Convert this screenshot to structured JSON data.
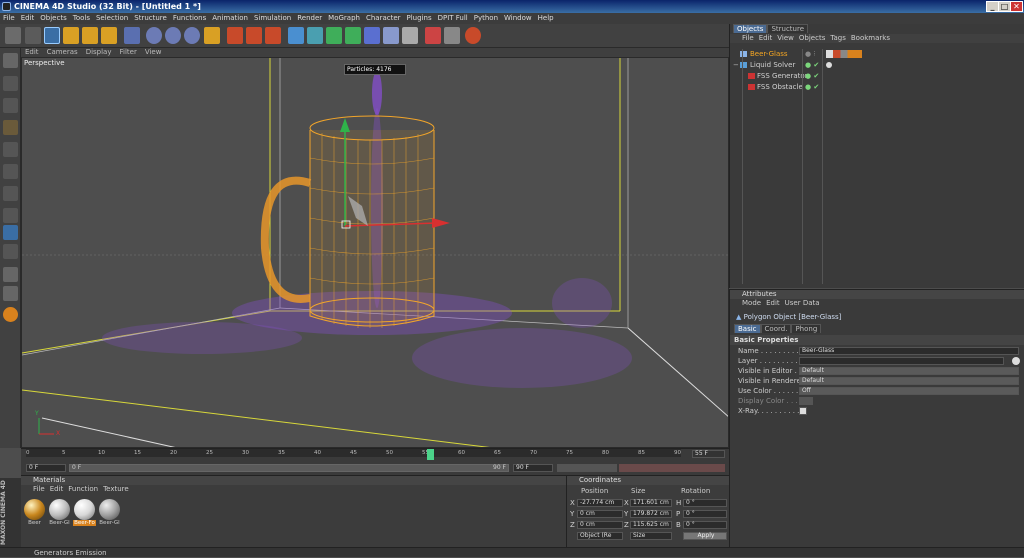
{
  "window": {
    "title": "CINEMA 4D Studio (32 Bit) - [Untitled 1 *]"
  },
  "menu": [
    "File",
    "Edit",
    "Objects",
    "Tools",
    "Selection",
    "Structure",
    "Functions",
    "Animation",
    "Simulation",
    "Render",
    "MoGraph",
    "Character",
    "Plugins",
    "DPIT Full",
    "Python",
    "Window",
    "Help"
  ],
  "viewport": {
    "menu": [
      "Edit",
      "Cameras",
      "Display",
      "Filter",
      "View"
    ],
    "label": "Perspective",
    "particles_label": "Particles: 4176",
    "axis_y": "Y",
    "axis_x": "X"
  },
  "timeline": {
    "ticks": [
      "0",
      "5",
      "10",
      "15",
      "20",
      "25",
      "30",
      "35",
      "40",
      "45",
      "50",
      "55",
      "60",
      "65",
      "70",
      "75",
      "80",
      "85",
      "90"
    ],
    "current_frame": "55 F",
    "start_field": "0 F",
    "start_field2": "0 F",
    "end_field": "90 F",
    "end_field2": "90 F"
  },
  "materials": {
    "title": "Materials",
    "menu": [
      "File",
      "Edit",
      "Function",
      "Texture"
    ],
    "items": [
      {
        "label": "Beer",
        "color": "#c8861d",
        "selected": false
      },
      {
        "label": "Beer-Gl",
        "color": "#bdbdbd",
        "selected": false
      },
      {
        "label": "Beer-Fo",
        "color": "#d8d8d8",
        "selected": true
      },
      {
        "label": "Beer-Gl",
        "color": "#a0a0a0",
        "selected": false
      }
    ]
  },
  "coordinates": {
    "title": "Coordinates",
    "headers": [
      "Position",
      "Size",
      "Rotation"
    ],
    "rows": [
      {
        "axis": "X",
        "pos": "-27.774 cm",
        "size": "171.601 cm",
        "rot_axis": "H",
        "rot": "0 °"
      },
      {
        "axis": "Y",
        "pos": "0 cm",
        "size": "179.872 cm",
        "rot_axis": "P",
        "rot": "0 °"
      },
      {
        "axis": "Z",
        "pos": "0 cm",
        "size": "115.625 cm",
        "rot_axis": "B",
        "rot": "0 °"
      }
    ],
    "mode": "Object (Re",
    "size_mode": "Size",
    "apply": "Apply"
  },
  "objects_panel": {
    "tabs": [
      "Objects",
      "Structure"
    ],
    "menu": [
      "File",
      "Edit",
      "View",
      "Objects",
      "Tags",
      "Bookmarks"
    ],
    "items": [
      {
        "name": "Beer-Glass",
        "indent": 0,
        "selected": true
      },
      {
        "name": "Liquid Solver",
        "indent": 0,
        "selected": false
      },
      {
        "name": "FSS Generator",
        "indent": 1,
        "selected": false
      },
      {
        "name": "FSS Obstacle",
        "indent": 1,
        "selected": false
      }
    ]
  },
  "attributes": {
    "title": "Attributes",
    "menu": [
      "Mode",
      "Edit",
      "User Data"
    ],
    "object_title": "Polygon Object [Beer-Glass]",
    "tabs": [
      "Basic",
      "Coord.",
      "Phong"
    ],
    "section": "Basic Properties",
    "rows": [
      {
        "label": "Name . . . . . . . . . . . . .",
        "value": "Beer-Glass",
        "type": "text"
      },
      {
        "label": "Layer . . . . . . . . . . . . .",
        "value": "",
        "type": "text"
      },
      {
        "label": "Visible in Editor . . .",
        "value": "Default",
        "type": "dropdown"
      },
      {
        "label": "Visible in Renderer",
        "value": "Default",
        "type": "dropdown"
      },
      {
        "label": "Use Color . . . . . . . .",
        "value": "Off",
        "type": "dropdown"
      },
      {
        "label": "Display Color . . .",
        "value": "",
        "type": "swatch"
      },
      {
        "label": "X-Ray. . . . . . . . . . .",
        "value": "",
        "type": "checkbox"
      }
    ]
  },
  "status": {
    "text": "Generators Emission"
  },
  "brand": "MAXON CINEMA 4D"
}
